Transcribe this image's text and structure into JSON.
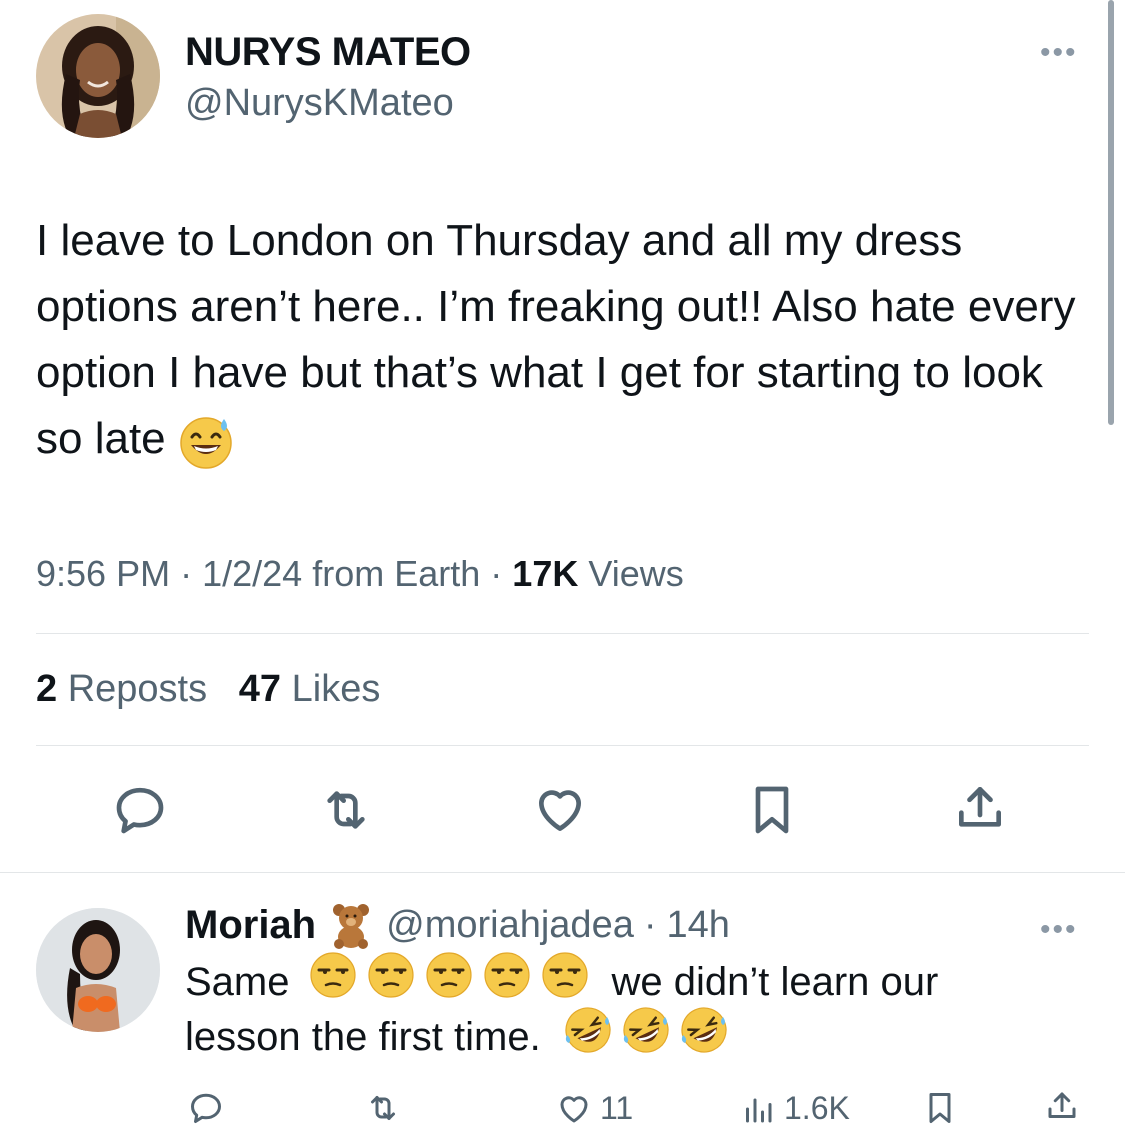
{
  "tweet": {
    "author_name": "NURYS MATEO",
    "author_handle": "@NurysKMateo",
    "more_label": "•••",
    "text_main": "I leave to London on Thursday and all my dress options aren’t here.. I’m freaking out!! Also hate every option I have but that’s what I get for starting to look so late",
    "text_emoji": "sweat-smile-emoji",
    "time": "9:56 PM",
    "date": "1/2/24",
    "source": "from Earth",
    "sep": "·",
    "views_count": "17K",
    "views_label": "Views",
    "reposts_count": "2",
    "reposts_label": "Reposts",
    "likes_count": "47",
    "likes_label": "Likes",
    "actions": [
      "reply-icon",
      "repost-icon",
      "like-icon",
      "bookmark-icon",
      "share-icon"
    ]
  },
  "reply": {
    "author_name": "Moriah",
    "author_badge": "teddy-bear-emoji",
    "author_handle": "@moriahjadea",
    "time": "14h",
    "sep": "·",
    "more_label": "•••",
    "text_start": "Same",
    "text_mid": "we didn’t learn our",
    "text_line2": "lesson the first time.",
    "emoji_line1": [
      "unamused-emoji",
      "unamused-emoji",
      "unamused-emoji",
      "unamused-emoji",
      "unamused-emoji"
    ],
    "emoji_line2": [
      "rofl-emoji",
      "rofl-emoji",
      "rofl-emoji"
    ],
    "likes_count": "11",
    "views_count": "1.6K"
  },
  "colors": {
    "text": "#0f1419",
    "secondary": "#536471",
    "divider": "#e3e6e8"
  }
}
